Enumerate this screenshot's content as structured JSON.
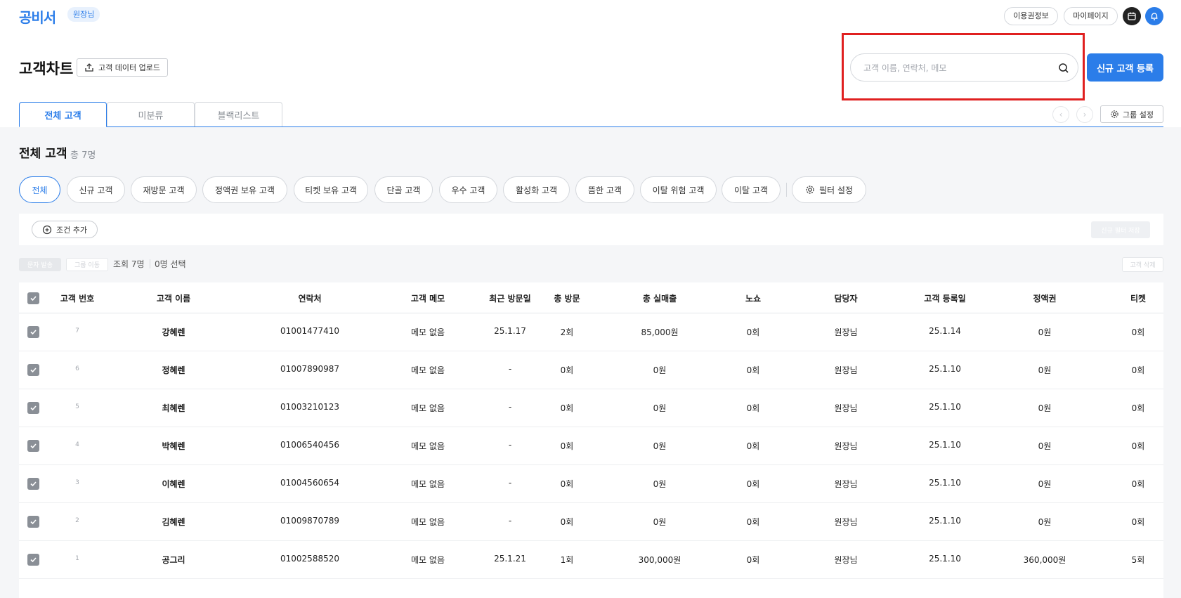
{
  "app": {
    "logo": "공비서",
    "role_badge": "원장님",
    "subscription_label": "이용권정보",
    "mypage_label": "마이페이지"
  },
  "header": {
    "title": "고객차트",
    "upload_label": "고객 데이터 업로드",
    "search_placeholder": "고객 이름, 연락처, 메모",
    "new_customer_label": "신규 고객 등록"
  },
  "tabs": [
    {
      "label": "전체 고객",
      "active": true
    },
    {
      "label": "미분류",
      "active": false
    },
    {
      "label": "블랙리스트",
      "active": false
    }
  ],
  "group_settings_label": "그룹 설정",
  "section": {
    "title": "전체 고객",
    "count": "총 7명"
  },
  "filter_chips": [
    {
      "label": "전체",
      "active": true
    },
    {
      "label": "신규 고객"
    },
    {
      "label": "재방문 고객"
    },
    {
      "label": "정액권 보유 고객"
    },
    {
      "label": "티켓 보유 고객"
    },
    {
      "label": "단골 고객"
    },
    {
      "label": "우수 고객"
    },
    {
      "label": "활성화 고객"
    },
    {
      "label": "뜸한 고객"
    },
    {
      "label": "이탈 위험 고객"
    },
    {
      "label": "이탈 고객"
    }
  ],
  "filter_settings_label": "필터 설정",
  "condition": {
    "add_label": "조건 추가",
    "save_filter_label": "신규 필터 저장"
  },
  "list_toolbar": {
    "send_label": "문자 발송",
    "move_label": "그룹 이동",
    "view_count": "조회 7명",
    "selected_count": "0명 선택",
    "delete_label": "고객 삭제"
  },
  "table": {
    "columns": [
      "고객 번호",
      "고객 이름",
      "연락처",
      "고객 메모",
      "최근 방문일",
      "총 방문",
      "총 실매출",
      "노쇼",
      "담당자",
      "고객 등록일",
      "정액권",
      "티켓"
    ],
    "rows": [
      [
        "7",
        "강혜렌",
        "01001477410",
        "메모 없음",
        "25.1.17",
        "2회",
        "85,000원",
        "0회",
        "원장님",
        "25.1.14",
        "0원",
        "0회"
      ],
      [
        "6",
        "정혜렌",
        "01007890987",
        "메모 없음",
        "-",
        "0회",
        "0원",
        "0회",
        "원장님",
        "25.1.10",
        "0원",
        "0회"
      ],
      [
        "5",
        "최혜렌",
        "01003210123",
        "메모 없음",
        "-",
        "0회",
        "0원",
        "0회",
        "원장님",
        "25.1.10",
        "0원",
        "0회"
      ],
      [
        "4",
        "박혜렌",
        "01006540456",
        "메모 없음",
        "-",
        "0회",
        "0원",
        "0회",
        "원장님",
        "25.1.10",
        "0원",
        "0회"
      ],
      [
        "3",
        "이혜렌",
        "01004560654",
        "메모 없음",
        "-",
        "0회",
        "0원",
        "0회",
        "원장님",
        "25.1.10",
        "0원",
        "0회"
      ],
      [
        "2",
        "김혜렌",
        "01009870789",
        "메모 없음",
        "-",
        "0회",
        "0원",
        "0회",
        "원장님",
        "25.1.10",
        "0원",
        "0회"
      ],
      [
        "1",
        "공그리",
        "01002588520",
        "메모 없음",
        "25.1.21",
        "1회",
        "300,000원",
        "0회",
        "원장님",
        "25.1.10",
        "360,000원",
        "5회"
      ]
    ]
  },
  "colors": {
    "accent": "#2b7de9",
    "highlight": "#e02020",
    "checkbox": "#8a8f96",
    "content_bg": "#f5f6f8"
  }
}
